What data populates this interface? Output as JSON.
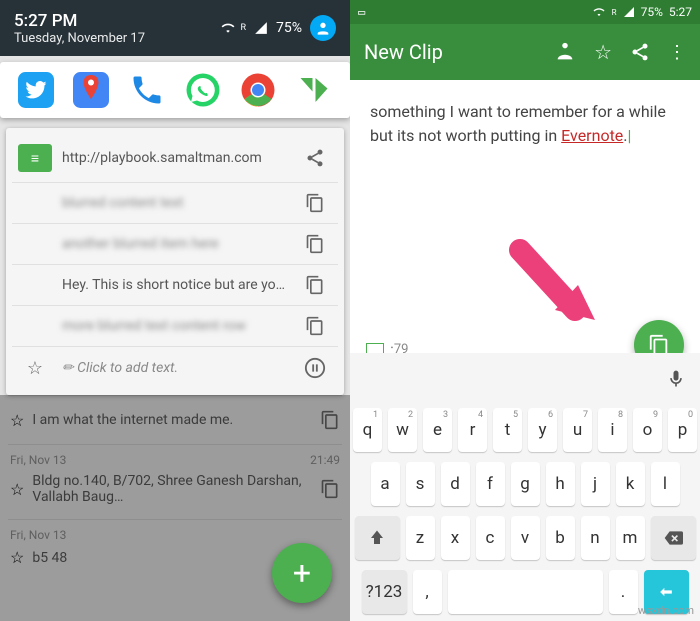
{
  "left": {
    "status": {
      "time": "5:27 PM",
      "date": "Tuesday, November 17",
      "battery": "75%",
      "signal_badge": "R"
    },
    "card_rows": {
      "url": "http://playbook.samaltman.com",
      "msg1": "Hey. This is short notice but are you…",
      "add_text": "Click to add text."
    },
    "bg": {
      "item1": "I am what the internet made me.",
      "date2": "Fri, Nov 13",
      "time2": "21:49",
      "item2": "Bldg no.140, B/702, Shree Ganesh Darshan, Vallabh Baug…",
      "date3": "Fri, Nov 13",
      "item3": "b5 48"
    }
  },
  "right": {
    "status": {
      "time": "5:27",
      "battery": "75%",
      "signal_badge": "R"
    },
    "title": "New Clip",
    "text_pre": "something I want to remember for a while but its not worth putting in ",
    "text_link": "Evernote",
    "text_post": ".",
    "counter": "79",
    "keyboard": {
      "num_mode": "?123",
      "row1": [
        [
          "q",
          "1"
        ],
        [
          "w",
          "2"
        ],
        [
          "e",
          "3"
        ],
        [
          "r",
          "4"
        ],
        [
          "t",
          "5"
        ],
        [
          "y",
          "6"
        ],
        [
          "u",
          "7"
        ],
        [
          "i",
          "8"
        ],
        [
          "o",
          "9"
        ],
        [
          "p",
          "0"
        ]
      ],
      "row2": [
        "a",
        "s",
        "d",
        "f",
        "g",
        "h",
        "j",
        "k",
        "l"
      ],
      "row3": [
        "z",
        "x",
        "c",
        "v",
        "b",
        "n",
        "m"
      ],
      "space": ",",
      "dot": "."
    }
  },
  "watermark": "wsxdn.com"
}
